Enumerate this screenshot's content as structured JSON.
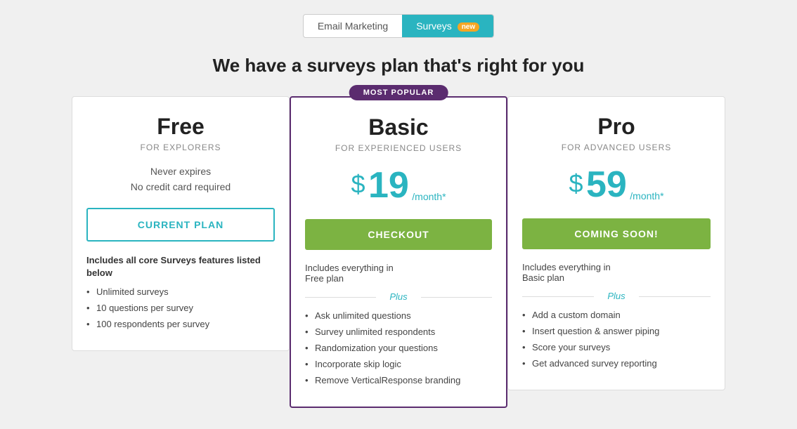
{
  "tabs": {
    "email_marketing": "Email Marketing",
    "surveys": "Surveys",
    "surveys_badge": "new"
  },
  "page_title": "We have a surveys plan that's right for you",
  "plans": [
    {
      "id": "free",
      "name": "Free",
      "subtitle": "FOR EXPLORERS",
      "most_popular": false,
      "free_info_line1": "Never expires",
      "free_info_line2": "No credit card required",
      "cta_label": "CURRENT PLAN",
      "cta_type": "current",
      "features_intro": "Includes all core Surveys features listed below",
      "features": [
        "Unlimited surveys",
        "10 questions per survey",
        "100 respondents per survey"
      ],
      "plus_features": []
    },
    {
      "id": "basic",
      "name": "Basic",
      "subtitle": "FOR EXPERIENCED USERS",
      "most_popular": true,
      "most_popular_label": "MOST POPULAR",
      "price_dollar": "$",
      "price_value": "19",
      "price_period": "/month*",
      "cta_label": "CHECKOUT",
      "cta_type": "checkout",
      "includes_text": "Includes everything in",
      "includes_plan": "Free plan",
      "plus_label": "Plus",
      "plus_features": [
        "Ask unlimited questions",
        "Survey unlimited respondents",
        "Randomization your questions",
        "Incorporate skip logic",
        "Remove VerticalResponse branding"
      ]
    },
    {
      "id": "pro",
      "name": "Pro",
      "subtitle": "FOR ADVANCED USERS",
      "most_popular": false,
      "price_dollar": "$",
      "price_value": "59",
      "price_period": "/month*",
      "cta_label": "COMING SOON!",
      "cta_type": "coming-soon",
      "includes_text": "Includes everything in",
      "includes_plan": "Basic plan",
      "plus_label": "Plus",
      "plus_features": [
        "Add a custom domain",
        "Insert question & answer piping",
        "Score your surveys",
        "Get advanced survey reporting"
      ]
    }
  ]
}
